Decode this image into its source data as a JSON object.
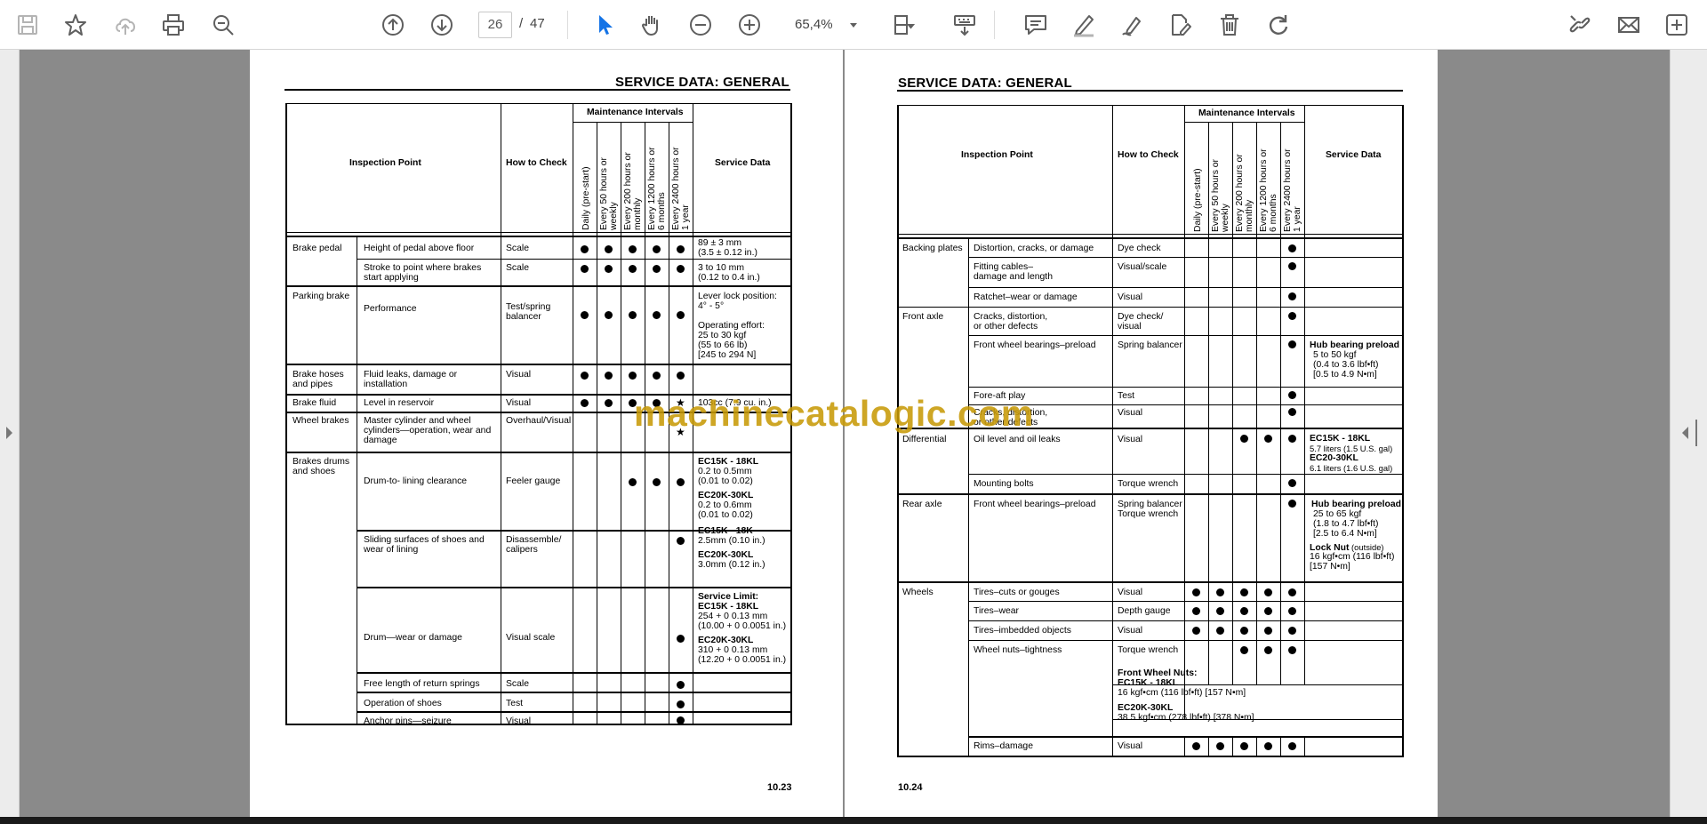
{
  "toolbar": {
    "page_current": "26",
    "page_separator": "/",
    "page_total": "47",
    "zoom": "65,4%"
  },
  "watermark": "machinecatalogic.com",
  "left_page": {
    "title": "SERVICE DATA: GENERAL",
    "page_number": "10.23",
    "headers": {
      "inspection_point": "Inspection Point",
      "how_to_check": "How to Check",
      "maintenance_intervals": "Maintenance Intervals",
      "service_data": "Service Data",
      "intervals": [
        "Daily (pre-start)",
        "Every 50 hours or\nweekly",
        "Every 200 hours or\nmonthly",
        "Every 1200 hours or\n6 months",
        "Every 2400 hours or\n1 year"
      ]
    },
    "groups": [
      {
        "name": "Brake pedal"
      },
      {
        "name": "Parking brake"
      },
      {
        "name": "Brake hoses\nand pipes"
      },
      {
        "name": "Brake fluid"
      },
      {
        "name": "Wheel brakes"
      },
      {
        "name": "Brakes drums\nand shoes"
      }
    ],
    "rows": [
      {
        "item": "Height of pedal above floor",
        "check": "Scale",
        "service": "89 ± 3 mm\n(3.5 ± 0.12 in.)"
      },
      {
        "item": "Stroke to point where brakes\nstart applying",
        "check": "Scale",
        "service": "3 to 10 mm\n(0.12 to 0.4 in.)"
      },
      {
        "item": "Performance",
        "check": "Test/spring\nbalancer",
        "service": "Lever lock position:\n4° - 5°\n\nOperating effort:\n25 to 30 kgf\n(55 to 66 lb)\n[245 to 294 N]"
      },
      {
        "item": "Fluid leaks, damage or\ninstallation",
        "check": "Visual",
        "service": ""
      },
      {
        "item": "Level in reservoir",
        "check": "Visual",
        "service": "103cc (7.9 cu. in.)"
      },
      {
        "item": "Master cylinder and wheel\ncylinders—operation, wear and\ndamage",
        "check": "Overhaul/Visual",
        "service": ""
      },
      {
        "item": "Drum-to- lining clearance",
        "check": "Feeler gauge",
        "service_bold1": "EC15K - 18KL",
        "service_text1": "0.2 to 0.5mm\n(0.01 to 0.02)",
        "service_bold2": "EC20K-30KL",
        "service_text2": "0.2 to 0.6mm\n(0.01 to 0.02)"
      },
      {
        "item": "Sliding surfaces of shoes and\nwear of lining",
        "check": "Disassemble/\ncalipers",
        "service_bold1": "EC15K - 18K",
        "service_text1": "2.5mm (0.10 in.)",
        "service_bold2": "EC20K-30KL",
        "service_text2": "3.0mm (0.12 in.)"
      },
      {
        "item": "Drum—wear or damage",
        "check": "Visual scale",
        "service_bold1": "Service Limit:\nEC15K - 18KL",
        "service_text1": "254 + 0 0.13 mm\n(10.00 + 0 0.0051 in.)",
        "service_bold2": "EC20K-30KL",
        "service_text2": "310 + 0 0.13 mm\n(12.20 + 0 0.0051 in.)"
      },
      {
        "item": "Free length of return springs",
        "check": "Scale",
        "service": ""
      },
      {
        "item": "Operation of shoes",
        "check": "Test",
        "service": ""
      },
      {
        "item": "Anchor pins—seizure",
        "check": "Visual",
        "service": ""
      }
    ]
  },
  "right_page": {
    "title": "SERVICE DATA: GENERAL",
    "page_number": "10.24",
    "headers": {
      "inspection_point": "Inspection Point",
      "how_to_check": "How to Check",
      "maintenance_intervals": "Maintenance Intervals",
      "service_data": "Service Data",
      "intervals": [
        "Daily (pre-start)",
        "Every 50 hours or\nweekly",
        "Every 200 hours or\nmonthly",
        "Every 1200 hours or\n6 months",
        "Every 2400 hours or\n1 year"
      ]
    },
    "groups": [
      {
        "name": "Backing plates"
      },
      {
        "name": "Front axle"
      },
      {
        "name": "Differential"
      },
      {
        "name": "Rear axle"
      },
      {
        "name": "Wheels"
      }
    ],
    "rows": [
      {
        "item": "Distortion, cracks, or damage",
        "check": "Dye check"
      },
      {
        "item": "Fitting cables–\ndamage and length",
        "check": "Visual/scale"
      },
      {
        "item": "Ratchet–wear or damage",
        "check": "Visual"
      },
      {
        "item": "Cracks, distortion,\nor other defects",
        "check": "Dye check/\nvisual"
      },
      {
        "item": "Front wheel bearings–preload",
        "check": "Spring balancer",
        "service_bold1": "Hub bearing preload",
        "service_text1": "5 to 50 kgf\n(0.4 to 3.6 lbf•ft)\n[0.5 to 4.9 N•m]"
      },
      {
        "item": "Fore-aft play",
        "check": "Test"
      },
      {
        "item": "Cracks, distortion,\nor other defects",
        "check": "Visual"
      },
      {
        "item": "Oil level and oil leaks",
        "check": "Visual",
        "service_bold1": "EC15K - 18KL",
        "service_text1": "5.7 liters (1.5 U.S. gal)",
        "service_bold2": "EC20-30KL",
        "service_text2": "6.1 liters (1.6 U.S. gal)"
      },
      {
        "item": "Mounting bolts",
        "check": "Torque wrench"
      },
      {
        "item": "Front wheel bearings–preload",
        "check": "Spring balancer\nTorque wrench",
        "service_bold1": "Hub bearing preload",
        "service_text1": "25 to 65 kgf\n(1.8 to 4.7 lbf•ft)\n[2.5 to 6.4 N•m]",
        "service_bold2": "Lock Nut",
        "service_suffix2": " (outside)",
        "service_text2": "16 kgf•cm (116 lbf•ft)\n[157 N•m]"
      },
      {
        "item": "Tires–cuts or gouges",
        "check": "Visual"
      },
      {
        "item": "Tires–wear",
        "check": "Depth gauge"
      },
      {
        "item": "Tires–imbedded objects",
        "check": "Visual"
      },
      {
        "item": "Wheel nuts–tightness",
        "check": "Torque wrench"
      },
      {
        "item": "Rims–damage",
        "check": "Visual"
      }
    ],
    "wheel_nuts_note": {
      "title": "Front Wheel Nuts:",
      "model1": "EC15K - 18KL",
      "text1": "16 kgf•cm (116 lbf•ft) [157 N•m]",
      "model2": "EC20K-30KL",
      "text2": "38.5 kgf•cm (278 lbf•ft) [378 N•m]"
    }
  },
  "colors": {
    "toolbar_icon": "#5f5f5f",
    "select_tool": "#1473e6",
    "viewer_bg": "#8a8a8a",
    "watermark": "#c89a08"
  }
}
